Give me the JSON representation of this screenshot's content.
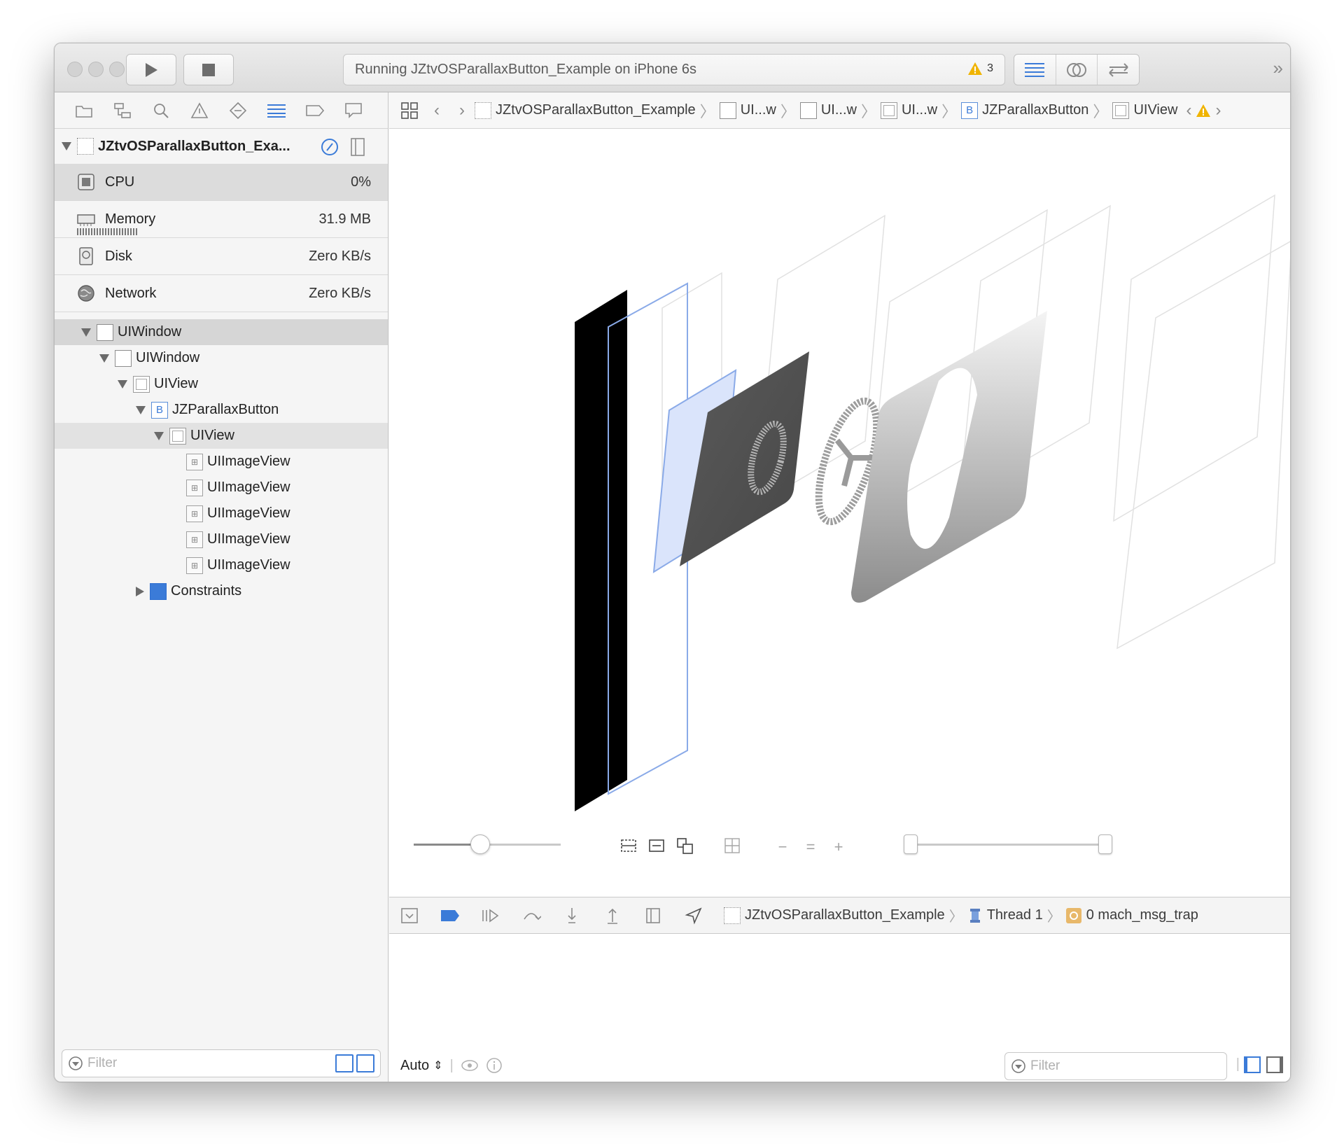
{
  "toolbar": {
    "activity_text": "Running JZtvOSParallaxButton_Example on iPhone 6s",
    "warning_count": "3"
  },
  "navigator": {
    "process_name": "JZtvOSParallaxButton_Exa...",
    "gauges": [
      {
        "label": "CPU",
        "value": "0%"
      },
      {
        "label": "Memory",
        "value": "31.9 MB"
      },
      {
        "label": "Disk",
        "value": "Zero KB/s"
      },
      {
        "label": "Network",
        "value": "Zero KB/s"
      }
    ],
    "tree": [
      {
        "label": "UIWindow"
      },
      {
        "label": "UIWindow"
      },
      {
        "label": "UIView"
      },
      {
        "label": "JZParallaxButton"
      },
      {
        "label": "UIView"
      },
      {
        "label": "UIImageView"
      },
      {
        "label": "UIImageView"
      },
      {
        "label": "UIImageView"
      },
      {
        "label": "UIImageView"
      },
      {
        "label": "UIImageView"
      },
      {
        "label": "Constraints"
      }
    ],
    "filter_placeholder": "Filter"
  },
  "jumpbar": {
    "items": [
      "JZtvOSParallaxButton_Example",
      "UI...w",
      "UI...w",
      "UI...w",
      "JZParallaxButton",
      "UIView"
    ]
  },
  "debugbar": {
    "target": "JZtvOSParallaxButton_Example",
    "thread": "Thread 1",
    "frame": "0 mach_msg_trap"
  },
  "console": {
    "mode": "Auto",
    "filter_placeholder": "Filter"
  },
  "canvas": {
    "spacing_level": 0.45
  }
}
